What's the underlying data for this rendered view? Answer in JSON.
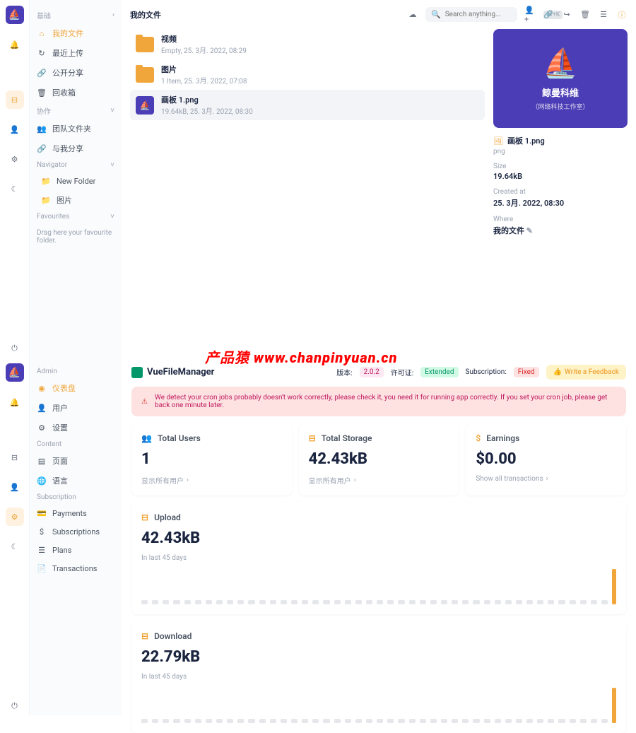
{
  "app1": {
    "sidebar": {
      "sections": {
        "basic": {
          "label": "基础",
          "items": [
            {
              "label": "我的文件",
              "active": true,
              "icon": "home-icon"
            },
            {
              "label": "最近上传",
              "icon": "clock-icon"
            },
            {
              "label": "公开分享",
              "icon": "link-icon"
            },
            {
              "label": "回收箱",
              "icon": "trash-icon"
            }
          ]
        },
        "collab": {
          "label": "协作",
          "items": [
            {
              "label": "团队文件夹",
              "icon": "users-icon"
            },
            {
              "label": "与我分享",
              "icon": "link-icon"
            }
          ]
        },
        "navigator": {
          "label": "Navigator",
          "items": [
            {
              "label": "New Folder",
              "icon": "folder-icon"
            },
            {
              "label": "图片",
              "icon": "folder-icon"
            }
          ]
        },
        "favourites": {
          "label": "Favourites",
          "hint": "Drag here your favourite folder."
        }
      }
    },
    "topbar": {
      "breadcrumb": "我的文件",
      "search_placeholder": "Search anything...",
      "shortcut": "⌘+K"
    },
    "files": [
      {
        "type": "folder",
        "name": "视频",
        "meta": "Empty, 25. 3月. 2022, 08:29"
      },
      {
        "type": "folder",
        "name": "图片",
        "meta": "1 Item, 25. 3月. 2022, 07:08"
      },
      {
        "type": "file",
        "name": "画板 1.png",
        "meta": "19.64kB, 25. 3月. 2022, 08:30",
        "selected": true
      }
    ],
    "details": {
      "preview_title": "鲸曼科维",
      "preview_sub": "（网络科技工作室）",
      "name": "画板 1.png",
      "ext": "png",
      "size_label": "Size",
      "size": "19.64kB",
      "created_label": "Created at",
      "created": "25. 3月. 2022, 08:30",
      "where_label": "Where",
      "where": "我的文件"
    }
  },
  "watermark": "产品猿  www.chanpinyuan.cn",
  "app2": {
    "sidebar": {
      "admin": {
        "label": "Admin",
        "items": [
          {
            "label": "仪表盘",
            "active": true,
            "icon": "gauge-icon"
          },
          {
            "label": "用户",
            "icon": "user-icon"
          },
          {
            "label": "设置",
            "icon": "gear-icon"
          }
        ]
      },
      "content": {
        "label": "Content",
        "items": [
          {
            "label": "页面",
            "icon": "page-icon"
          },
          {
            "label": "语言",
            "icon": "globe-icon"
          }
        ]
      },
      "subscription": {
        "label": "Subscription",
        "items": [
          {
            "label": "Payments",
            "icon": "card-icon"
          },
          {
            "label": "Subscriptions",
            "icon": "dollar-icon"
          },
          {
            "label": "Plans",
            "icon": "list-icon"
          },
          {
            "label": "Transactions",
            "icon": "doc-icon"
          }
        ]
      }
    },
    "header": {
      "brand": "VueFileManager",
      "version_label": "版本:",
      "version": "2.0.2",
      "license_label": "许可证:",
      "license": "Extended",
      "subscription_label": "Subscription:",
      "subscription": "Fixed",
      "feedback": "Write a Feedback"
    },
    "alert": "We detect your cron jobs probably doesn't work correctly, please check it, you need it for running app correctly. If you set your cron job, please get back one minute later.",
    "cards": [
      {
        "icon": "users-icon",
        "title": "Total Users",
        "value": "1",
        "link": "显示所有用户"
      },
      {
        "icon": "drive-icon",
        "title": "Total Storage",
        "value": "42.43kB",
        "link": "显示所有用户"
      },
      {
        "icon": "dollar-icon",
        "title": "Earnings",
        "value": "$0.00",
        "link": "Show all transactions"
      }
    ],
    "upload": {
      "title": "Upload",
      "value": "42.43kB",
      "sub": "In last 45 days"
    },
    "download": {
      "title": "Download",
      "value": "22.79kB",
      "sub": "In last 45 days"
    }
  },
  "chart_data": [
    {
      "type": "bar",
      "title": "Upload",
      "categories_count": 45,
      "values_description": "44 days near-zero, last day 42.43kB",
      "ylabel": "",
      "ylim": [
        0,
        45
      ]
    },
    {
      "type": "bar",
      "title": "Download",
      "categories_count": 45,
      "values_description": "44 days near-zero, last day 22.79kB",
      "ylabel": "",
      "ylim": [
        0,
        25
      ]
    }
  ]
}
